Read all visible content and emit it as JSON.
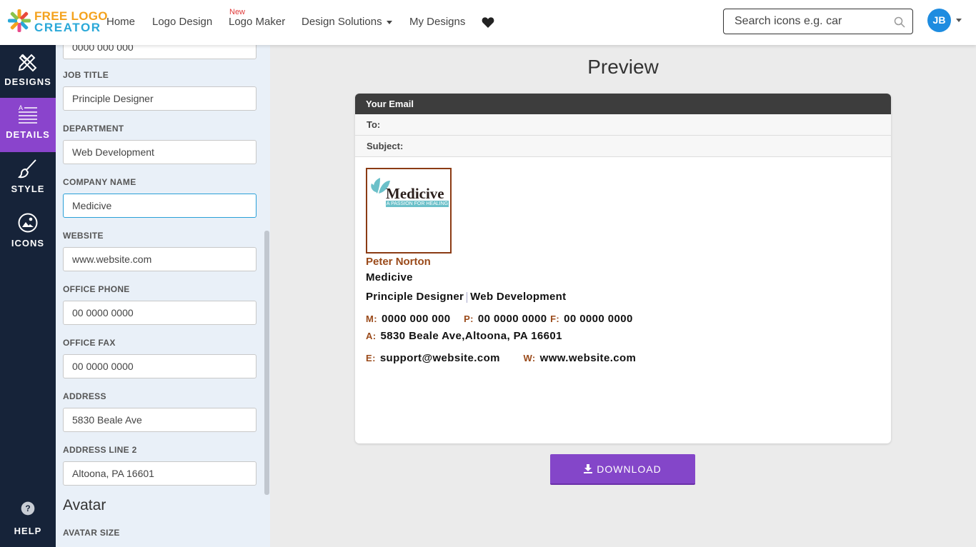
{
  "header": {
    "logo_line1": "FREE LOGO",
    "logo_line2": "CREATOR",
    "nav": {
      "home": "Home",
      "logo_design": "Logo Design",
      "new_badge": "New",
      "logo_maker": "Logo Maker",
      "design_solutions": "Design Solutions",
      "my_designs": "My Designs"
    },
    "search_placeholder": "Search icons e.g. car",
    "avatar_initials": "JB"
  },
  "leftnav": {
    "designs": "DESIGNS",
    "details": "DETAILS",
    "style": "STYLE",
    "icons": "ICONS",
    "help": "HELP"
  },
  "form": {
    "mobile_value": "0000 000 000",
    "job_title_label": "JOB TITLE",
    "job_title_value": "Principle Designer",
    "department_label": "DEPARTMENT",
    "department_value": "Web Development",
    "company_label": "COMPANY NAME",
    "company_value": "Medicive",
    "website_label": "WEBSITE",
    "website_value": "www.website.com",
    "office_phone_label": "OFFICE PHONE",
    "office_phone_value": "00 0000 0000",
    "office_fax_label": "OFFICE FAX",
    "office_fax_value": "00 0000 0000",
    "address_label": "ADDRESS",
    "address_value": "5830 Beale Ave",
    "address2_label": "ADDRESS LINE 2",
    "address2_value": "Altoona, PA 16601",
    "avatar_section": "Avatar",
    "avatar_size_label": "AVATAR SIZE"
  },
  "preview": {
    "title": "Preview",
    "email_header": "Your Email",
    "to_label": "To:",
    "subject_label": "Subject:",
    "logo_brand": "Medicive",
    "logo_tagline": "A PASSION FOR HEALING",
    "name": "Peter Norton",
    "company": "Medicive",
    "job_title": "Principle Designer",
    "department": "Web Development",
    "m_key": "M:",
    "m_val": "0000 000 000",
    "p_key": "P:",
    "p_val": "00 0000 0000",
    "f_key": "F:",
    "f_val": "00 0000 0000",
    "a_key": "A:",
    "a_val": "5830 Beale Ave,Altoona, PA 16601",
    "e_key": "E:",
    "e_val": "support@website.com",
    "w_key": "W:",
    "w_val": "www.website.com"
  },
  "download_label": "DOWNLOAD",
  "colors": {
    "accent": "#8446c9",
    "nav_bg": "#162339",
    "sig_accent": "#9a4a1a",
    "avatar": "#1e8ce0"
  }
}
